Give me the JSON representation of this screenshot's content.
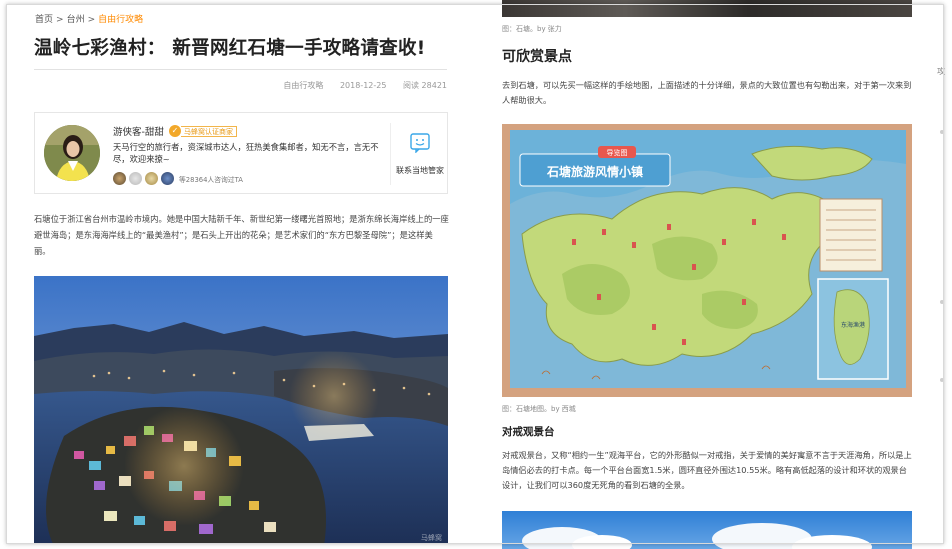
{
  "breadcrumb": {
    "items": [
      "首页",
      "台州",
      "自由行攻略"
    ],
    "separator": ">"
  },
  "article": {
    "title": "温岭七彩渔村： 新晋网红石塘一手攻略请查收!",
    "category": "自由行攻略",
    "date": "2018-12-25",
    "views_label": "阅读",
    "views": "28421"
  },
  "author": {
    "name": "游侠客-甜甜",
    "verified_label": "马蜂窝认证商家",
    "bio": "天马行空的旅行者，资深城市达人，狂热美食集邮者，知无不言，言无不尽，欢迎来撩~",
    "visitors_text": "等28364人咨询过TA",
    "contact_label": "联系当地管家"
  },
  "intro_text": "石塘位于浙江省台州市温岭市境内。她是中国大陆新千年、新世纪第一缕曙光首照地；是浙东绵长海岸线上的一座避世海岛；是东海海岸线上的“最美渔村”；是石头上开出的花朵；是艺术家们的“东方巴黎圣母院”；是这样美丽。",
  "photo1": {
    "credit": "马蜂窝"
  },
  "right": {
    "caption1": "图：石塘。by 张力",
    "section_title": "可欣赏景点",
    "section_text": "去到石塘，可以先买一幅这样的手绘地图，上面描述的十分详细，景点的大致位置也有勾勒出来，对于第一次来到人帮助很大。",
    "map_title": "石塘旅游风情小镇",
    "map_tag": "导览图",
    "map_inset": "东海渔港",
    "caption2": "图：石塘地图。by 西城",
    "subsection_title": "对戒观景台",
    "subsection_text": "对戒观景台，又称“相约一生”观海平台，它的外形酷似一对戒指，关于爱情的美好寓意不言于天涯海角，所以是上岛情侣必去的打卡点。每一个平台台面宽1.5米，圆环直径外围达10.55米。略有高低起落的设计和环状的观景台设计，让我们可以360度无死角的看到石塘的全景。"
  },
  "gutter": {
    "mark": "攻"
  },
  "colors": {
    "accent": "#ff8a00",
    "verify": "#f2a82a",
    "contact_icon": "#3aa7e8"
  }
}
